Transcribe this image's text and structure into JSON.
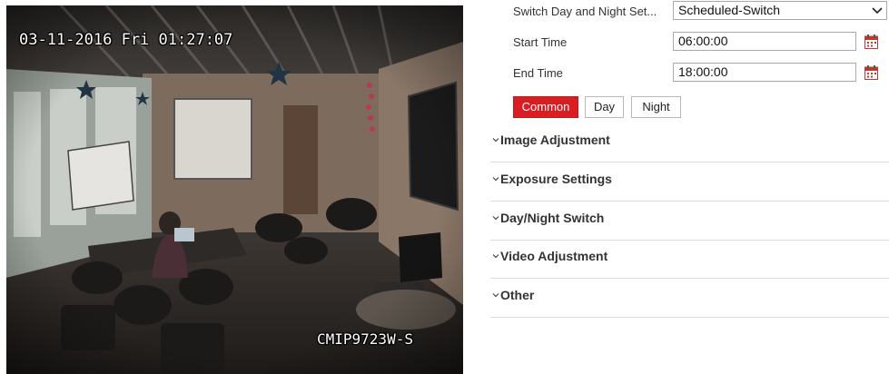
{
  "video": {
    "osd_timestamp": "03-11-2016 Fri 01:27:07",
    "osd_camera_name": "CMIP9723W-S"
  },
  "schedule": {
    "switch_label": "Switch Day and Night Set...",
    "switch_value": "Scheduled-Switch",
    "start_label": "Start Time",
    "start_value": "06:00:00",
    "end_label": "End Time",
    "end_value": "18:00:00"
  },
  "modes": {
    "common": "Common",
    "day": "Day",
    "night": "Night",
    "active": "Common"
  },
  "sections": [
    {
      "title": "Image Adjustment"
    },
    {
      "title": "Exposure Settings"
    },
    {
      "title": "Day/Night Switch"
    },
    {
      "title": "Video Adjustment"
    },
    {
      "title": "Other"
    }
  ],
  "colors": {
    "accent": "#d81e23",
    "calendar_icon": "#c0392b"
  },
  "icons": {
    "dropdown": "chevron-down-icon",
    "calendar": "calendar-icon",
    "section_toggle": "chevron-down-icon"
  }
}
